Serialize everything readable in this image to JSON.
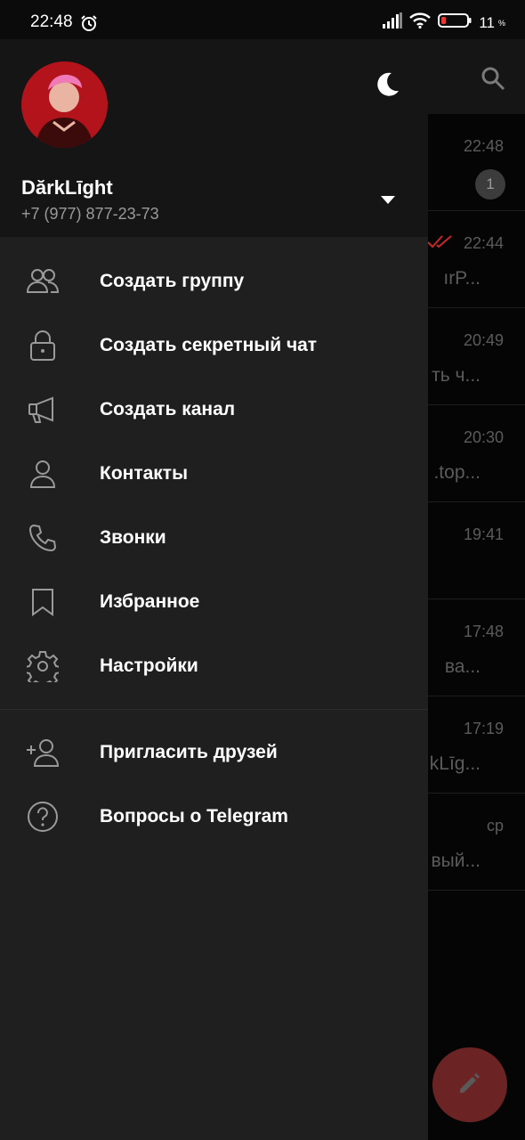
{
  "status_bar": {
    "time": "22:48",
    "battery": "11",
    "battery_unit": "%"
  },
  "chat_list": {
    "rows": [
      {
        "time": "22:48",
        "preview": "",
        "unread": "1"
      },
      {
        "time": "22:44",
        "preview": "ırP..."
      },
      {
        "time": "20:49",
        "preview": "ть ч..."
      },
      {
        "time": "20:30",
        "preview": ".top..."
      },
      {
        "time": "19:41",
        "preview": ""
      },
      {
        "time": "17:48",
        "preview": "ва..."
      },
      {
        "time": "17:19",
        "preview": "kLīg..."
      },
      {
        "time": "ср",
        "preview": "вый..."
      }
    ]
  },
  "drawer": {
    "username": "DărkLīght",
    "phone": "+7 (977) 877-23-73",
    "menu": [
      {
        "label": "Создать группу",
        "icon": "group-icon"
      },
      {
        "label": "Создать секретный чат",
        "icon": "lock-icon"
      },
      {
        "label": "Создать канал",
        "icon": "megaphone-icon"
      },
      {
        "label": "Контакты",
        "icon": "contact-icon"
      },
      {
        "label": "Звонки",
        "icon": "phone-icon"
      },
      {
        "label": "Избранное",
        "icon": "bookmark-icon"
      },
      {
        "label": "Настройки",
        "icon": "gear-icon"
      }
    ],
    "menu_secondary": [
      {
        "label": "Пригласить друзей",
        "icon": "add-user-icon"
      },
      {
        "label": "Вопросы о Telegram",
        "icon": "help-icon"
      }
    ]
  },
  "colors": {
    "accent": "#e53935",
    "drawer_bg": "#1f1f1f",
    "header_bg": "#151515"
  }
}
